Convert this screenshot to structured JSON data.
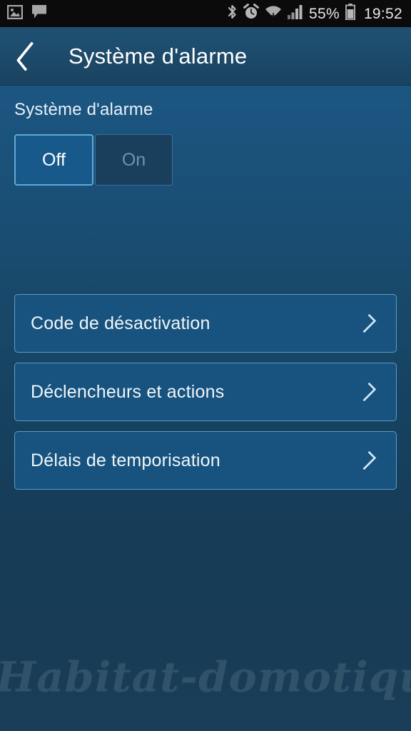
{
  "statusbar": {
    "left_icons": [
      {
        "name": "photo-icon",
        "glyph": "image"
      },
      {
        "name": "message-icon",
        "glyph": "chat-bubble"
      }
    ],
    "right_icons": [
      {
        "name": "bluetooth-icon",
        "glyph": "bluetooth"
      },
      {
        "name": "alarm-clock-icon",
        "glyph": "alarm"
      },
      {
        "name": "wifi-icon",
        "glyph": "wifi"
      },
      {
        "name": "cellular-signal-icon",
        "glyph": "signal-bars"
      }
    ],
    "battery_percent": "55%",
    "battery_icon_name": "battery-icon",
    "clock": "19:52"
  },
  "appbar": {
    "back_icon_name": "back-chevron-icon",
    "title": "Système d'alarme"
  },
  "main": {
    "section_label": "Système d'alarme",
    "segmented": {
      "options": [
        {
          "label": "Off",
          "selected": true
        },
        {
          "label": "On",
          "selected": false
        }
      ],
      "selected_value": "Off"
    },
    "rows": [
      {
        "label": "Code de désactivation",
        "chevron": "chevron-right-icon"
      },
      {
        "label": "Déclencheurs et actions",
        "chevron": "chevron-right-icon"
      },
      {
        "label": "Délais de temporisation",
        "chevron": "chevron-right-icon"
      }
    ]
  },
  "watermark": {
    "text": "Habitat-domotique.fr"
  },
  "colors": {
    "statusbar_bg": "#0b0b0b",
    "appbar_bg": "#1d4b6b",
    "content_bg_top": "#1b5682",
    "content_bg_bottom": "#1b3e58",
    "card_bg": "#17537e",
    "card_border": "#5a9cc6",
    "segment_selected_bg": "#18598c",
    "segment_selected_border": "#5fa9d8",
    "segment_unselected_bg": "#1a3f5d",
    "text_primary": "#ffffff",
    "text_muted": "#6f93ad"
  }
}
